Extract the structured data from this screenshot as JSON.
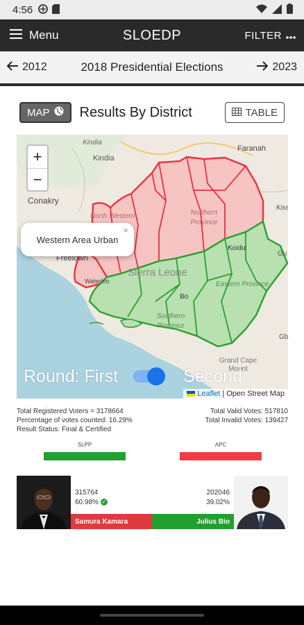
{
  "status_bar": {
    "time": "4:56"
  },
  "appbar": {
    "menu_label": "Menu",
    "title": "SLOEDP",
    "filter_label": "FILTER"
  },
  "nav": {
    "prev_year": "2012",
    "title": "2018 Presidential Elections",
    "next_year": "2023"
  },
  "view": {
    "map_label": "MAP",
    "title": "Results By District",
    "table_label": "TABLE"
  },
  "map": {
    "popup_text": "Western Area Urban",
    "popup_close": "×",
    "round_first": "Round: First",
    "round_second": "Second",
    "round_selected": "Second",
    "attribution_leaflet": "Leaflet",
    "attribution_osm": "| Open Street Map",
    "labels": {
      "kindia_top": "Kindia",
      "kindia": "Kindia",
      "conakry": "Conakry",
      "faranah": "Faranah",
      "kissi": "Kiss",
      "north_western": "North Western",
      "northern_province": "Northern Province",
      "koidu": "Koidu",
      "freetown": "Freetown",
      "waterloo": "Waterloo",
      "sierra_leone": "Sierra Leone",
      "bo": "Bo",
      "eastern_province": "Eastern Province",
      "southern_province": "Southern Province",
      "grand_cape_mount": "Grand Cape Mount",
      "gu": "Gu",
      "gb": "Gb"
    },
    "colors": {
      "apc": "#e8323c",
      "slpp": "#2aa02e",
      "apc_fill": "#f7c4c4",
      "slpp_fill": "#b8e0b0"
    }
  },
  "stats": {
    "registered": "Total Registered Voters = 3178664",
    "percentage": "Percentage of votes counted: 16.29%",
    "status": "Result Status: Final & Certified",
    "valid": "Total Valid Votes: 517810",
    "invalid": "Total Invalid Votes: 139427"
  },
  "parties": [
    {
      "name": "SLPP",
      "color": "#22a02e"
    },
    {
      "name": "APC",
      "color": "#ee3e44"
    }
  ],
  "candidates": [
    {
      "name": "Samura Kamara",
      "votes": "315764",
      "percent": "60.98%",
      "winner": true,
      "bar_color": "#e03a40"
    },
    {
      "name": "Julius Bio",
      "votes": "202046",
      "percent": "39.02%",
      "winner": false,
      "bar_color": "#22a02e"
    }
  ]
}
